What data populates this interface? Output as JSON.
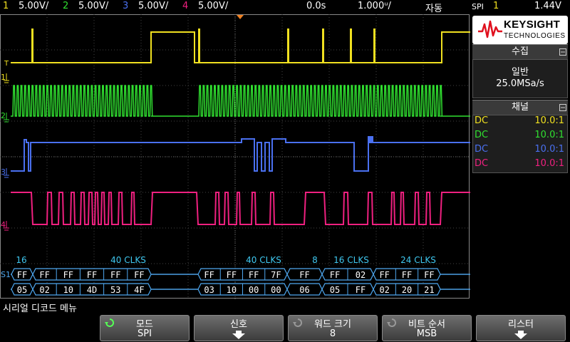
{
  "topbar": {
    "ch1_num": "1",
    "ch1_scale": "5.00V/",
    "ch2_num": "2",
    "ch2_scale": "5.00V/",
    "ch3_num": "3",
    "ch3_scale": "5.00V/",
    "ch4_num": "4",
    "ch4_scale": "5.00V/",
    "time_position": "0.0s",
    "time_scale": "1.000ᵘ/",
    "trigger_mode": "자동",
    "trigger_type": "SPI",
    "trigger_source": "1",
    "trigger_level": "1.44V"
  },
  "colors": {
    "ch1": "#f0e020",
    "ch2": "#30e030",
    "ch3": "#4a70f0",
    "ch4": "#f02080",
    "bus": "#4fa8f0",
    "bus_text": "#ffffff",
    "label_cyan": "#3fc8f0"
  },
  "markers": {
    "ch1": "1",
    "ch2": "2",
    "ch3": "3",
    "ch4": "4",
    "trigger": "T",
    "serial": "S1"
  },
  "bus": {
    "annotations": [
      "16",
      "40 CLKS",
      "40 CLKS",
      "8",
      "16 CLKS",
      "24 CLKS"
    ],
    "mosi_row": [
      "FF",
      "FF",
      "FF",
      "FF",
      "FF",
      "FF",
      "FF",
      "FF",
      "FF",
      "7F",
      "FF",
      "FF",
      "02",
      "FF",
      "FF",
      "FF"
    ],
    "miso_row": [
      "05",
      "02",
      "10",
      "4D",
      "53",
      "4F",
      "03",
      "10",
      "00",
      "00",
      "06",
      "05",
      "FF",
      "02",
      "20",
      "21"
    ]
  },
  "panel": {
    "brand_name": "KEYSIGHT",
    "brand_sub": "TECHNOLOGIES",
    "acq_header": "수집",
    "acq_mode": "일반",
    "acq_rate": "25.0MSa/s",
    "ch_header": "채널",
    "channels": [
      {
        "coupling": "DC",
        "probe": "10.0:1"
      },
      {
        "coupling": "DC",
        "probe": "10.0:1"
      },
      {
        "coupling": "DC",
        "probe": "10.0:1"
      },
      {
        "coupling": "DC",
        "probe": "10.0:1"
      }
    ]
  },
  "softkeys": {
    "menu_title": "시리얼 디코드 메뉴",
    "mode_label": "모드",
    "mode_value": "SPI",
    "signal_label": "신호",
    "word_size_label": "워드 크기",
    "word_size_value": "8",
    "bit_order_label": "비트 순서",
    "bit_order_value": "MSB",
    "lister_label": "리스터"
  }
}
